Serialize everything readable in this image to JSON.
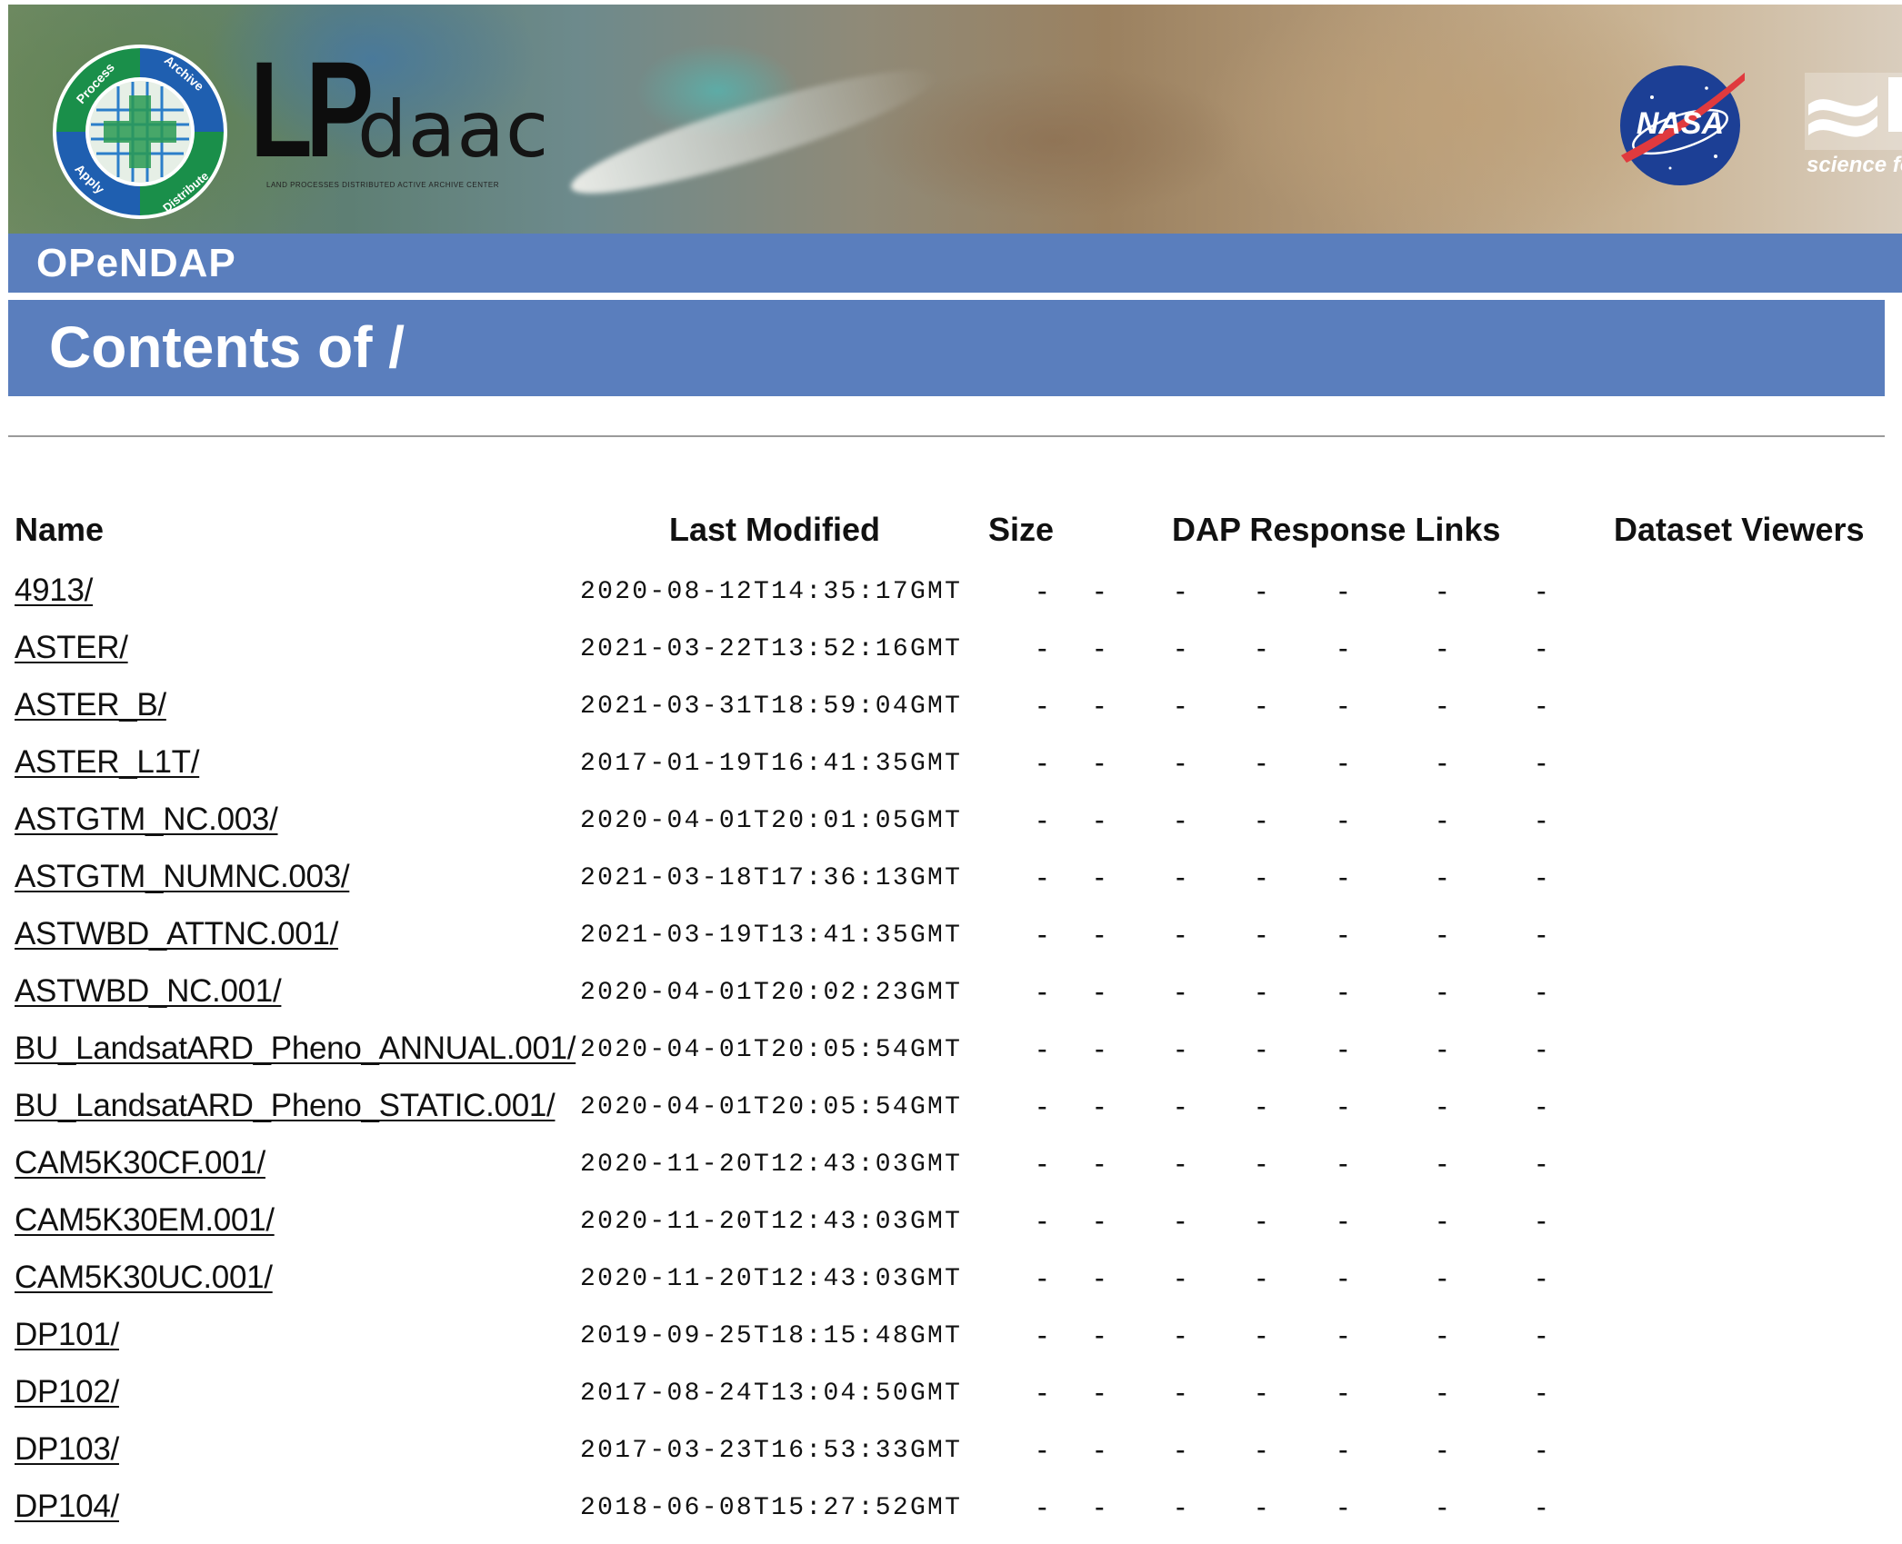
{
  "banner": {
    "logo_lp": "LP",
    "logo_daac": "daac",
    "logo_tagline": "LAND PROCESSES DISTRIBUTED ACTIVE ARCHIVE CENTER",
    "logo_ring_words": [
      "Process",
      "Archive",
      "Distribute",
      "Apply"
    ],
    "nasa_label": "NASA",
    "usgs_tagline": "science fo"
  },
  "header": {
    "service_name": "OPeNDAP",
    "title": "Contents of /"
  },
  "table": {
    "columns": [
      "Name",
      "Last Modified",
      "Size",
      "DAP Response Links",
      "Dataset Viewers"
    ],
    "placeholder": "-",
    "rows": [
      {
        "name": "4913/",
        "modified": "2020-08-12T14:35:17GMT"
      },
      {
        "name": "ASTER/",
        "modified": "2021-03-22T13:52:16GMT"
      },
      {
        "name": "ASTER_B/",
        "modified": "2021-03-31T18:59:04GMT"
      },
      {
        "name": "ASTER_L1T/",
        "modified": "2017-01-19T16:41:35GMT"
      },
      {
        "name": "ASTGTM_NC.003/",
        "modified": "2020-04-01T20:01:05GMT"
      },
      {
        "name": "ASTGTM_NUMNC.003/",
        "modified": "2021-03-18T17:36:13GMT"
      },
      {
        "name": "ASTWBD_ATTNC.001/",
        "modified": "2021-03-19T13:41:35GMT"
      },
      {
        "name": "ASTWBD_NC.001/",
        "modified": "2020-04-01T20:02:23GMT"
      },
      {
        "name": "BU_LandsatARD_Pheno_ANNUAL.001/",
        "modified": "2020-04-01T20:05:54GMT"
      },
      {
        "name": "BU_LandsatARD_Pheno_STATIC.001/",
        "modified": "2020-04-01T20:05:54GMT"
      },
      {
        "name": "CAM5K30CF.001/",
        "modified": "2020-11-20T12:43:03GMT"
      },
      {
        "name": "CAM5K30EM.001/",
        "modified": "2020-11-20T12:43:03GMT"
      },
      {
        "name": "CAM5K30UC.001/",
        "modified": "2020-11-20T12:43:03GMT"
      },
      {
        "name": "DP101/",
        "modified": "2019-09-25T18:15:48GMT"
      },
      {
        "name": "DP102/",
        "modified": "2017-08-24T13:04:50GMT"
      },
      {
        "name": "DP103/",
        "modified": "2017-03-23T16:53:33GMT"
      },
      {
        "name": "DP104/",
        "modified": "2018-06-08T15:27:52GMT"
      }
    ]
  }
}
